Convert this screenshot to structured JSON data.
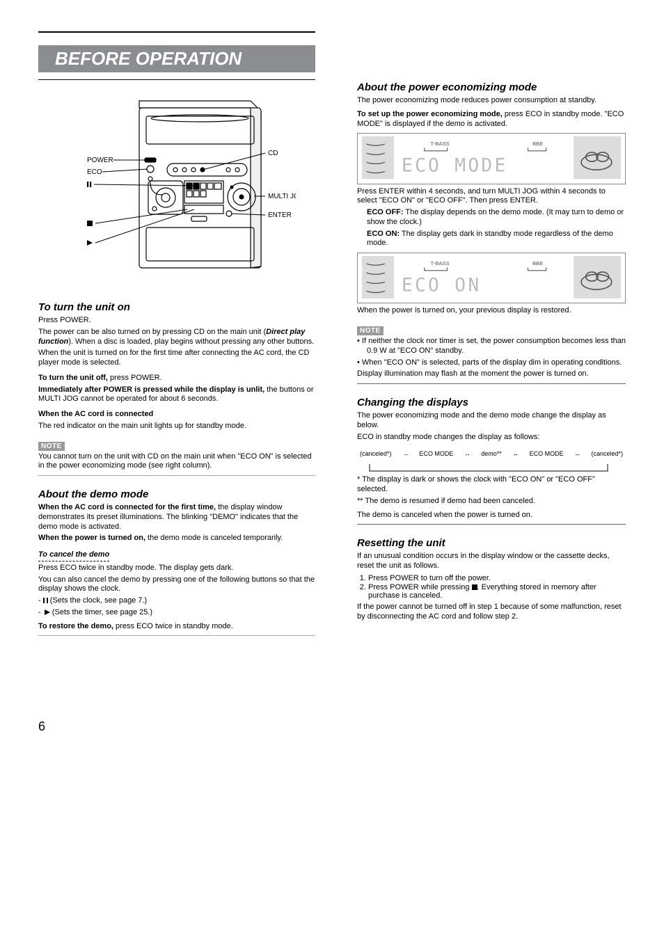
{
  "page_number": "6",
  "title": "BEFORE OPERATION",
  "diagram": {
    "labels": [
      "POWER",
      "ECO",
      "CD",
      "MULTI JOG",
      "ENTER"
    ],
    "button_icons": [
      "pause",
      "stop",
      "play"
    ]
  },
  "left": {
    "sec1_title": "To turn the unit on",
    "sec1_p1": "Press POWER.",
    "sec1_p2_a": "The power can be also turned on by pressing CD on the main unit (",
    "sec1_p2_fn": "Direct play function",
    "sec1_p2_b": "). When a disc is loaded, play begins without pressing any other buttons.",
    "sec1_p3": "When the unit is turned on for the first time after connecting the AC cord, the CD player mode is selected.",
    "sec1_off_label": "To turn the unit off,",
    "sec1_off_text": " press POWER.",
    "sec1_unlit_label": "Immediately after POWER is pressed while the display is unlit,",
    "sec1_unlit_text": " the buttons or MULTI JOG cannot be operated for about 6 seconds.",
    "sec1_standby_label": "When the AC cord is connected",
    "sec1_standby_text": "The red indicator on the main unit lights up for standby mode.",
    "note_label": "NOTE",
    "sec1_note": "You cannot turn on the unit with CD on the main unit when \"ECO ON\" is selected in the power economizing mode (see right column).",
    "sec2_title": "About the demo mode",
    "sec2_p1a_label": "When the AC cord is connected for the first time,",
    "sec2_p1a_text": " the display window demonstrates its preset illuminations. The blinking \"DEMO\" indicates that the demo mode is activated.",
    "sec2_p1b_label": "When the power is turned on,",
    "sec2_p1b_text": " the demo mode is canceled temporarily.",
    "sec2_under": "To cancel the demo",
    "sec2_cancel_p": "Press ECO twice in standby mode. The display gets dark.",
    "sec2_cancel_li_intro": "You can also cancel the demo by pressing one of the following buttons so that the display shows the clock.",
    "sec2_li1_sym": "pause",
    "sec2_li1_txt": " (Sets the clock, see page 7.)",
    "sec2_li2_sym": "play",
    "sec2_li2_txt": " (Sets the timer, see page 25.)",
    "sec2_reset_label": "To restore the demo,",
    "sec2_reset_text": " press ECO twice in standby mode."
  },
  "right": {
    "sec3_title": "About the power economizing mode",
    "sec3_p1": "The power economizing mode reduces power consumption at standby.",
    "sec3_setup_label": "To set up the power economizing mode,",
    "sec3_setup_text": " press ECO in standby mode. \"ECO MODE\" is displayed if the demo is activated.",
    "disp1": "ECO   MODE",
    "sec3_p2": "Press ENTER within 4 seconds, and turn MULTI JOG within 4 seconds to select \"ECO ON\" or \"ECO OFF\". Then press ENTER.",
    "sec3_ecooff_label": "ECO OFF:",
    "sec3_ecooff_text": " The display depends on the demo mode. (It may turn to demo or show the clock.)",
    "sec3_ecoon_label": "ECO ON:",
    "sec3_ecoon_text": " The display gets dark in standby mode regardless of the demo mode.",
    "disp2": "ECO   ON",
    "sec3_p3": "When the power is turned on, your previous display is restored.",
    "sec3_note1": "If neither the clock nor timer is set, the power consumption becomes less than 0.9 W at \"ECO ON\" standby.",
    "sec3_note2": "When \"ECO ON\" is selected, parts of the display dim in operating conditions.",
    "sec3_flash": "Display illumination may flash at the moment the power is turned on.",
    "sec4_title": "Changing the displays",
    "sec4_p1": "The power economizing mode and the demo mode change the display as below.",
    "sec4_p2": "ECO in standby mode changes the display as follows:",
    "flow": [
      "(canceled*)",
      "ECO MODE",
      "demo**",
      "ECO MODE",
      "(canceled*)"
    ],
    "sec4_f1": "* The display is dark or shows the clock with \"ECO ON\" or \"ECO OFF\" selected.",
    "sec4_f2": "** The demo is resumed if demo had been canceled.",
    "sec4_p3": "The demo is canceled when the power is turned on.",
    "sec5_title": "Resetting the unit",
    "sec5_p1_a": "If an unusual condition occurs in the display window or the cassette decks, reset the unit as follows.",
    "sec5_li1": "Press POWER to turn off the power.",
    "sec5_li2_a": "Press POWER while pressing ",
    "sec5_li2_sym": "stop",
    "sec5_li2_b": ". Everything stored in memory after purchase is canceled.",
    "sec5_p2": "If the power cannot be turned off in step 1 because of some malfunction, reset by disconnecting the AC cord and follow step 2."
  }
}
